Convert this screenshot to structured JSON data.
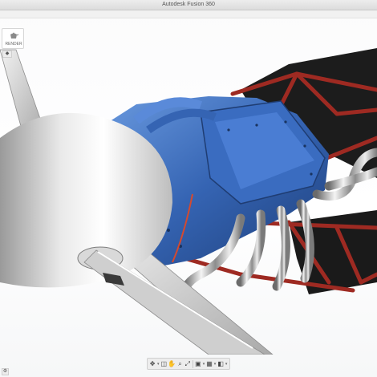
{
  "window": {
    "title": "Autodesk Fusion 360"
  },
  "workspace": {
    "label": "RENDER",
    "icon": "teapot-icon"
  },
  "browser": {
    "toggle_icon": "collapse-icon"
  },
  "settings": {
    "icon": "gear-icon"
  },
  "navbar": {
    "items": [
      {
        "name": "move-icon",
        "glyph": "✥"
      },
      {
        "name": "look-at-icon",
        "glyph": "◫"
      },
      {
        "name": "pan-icon",
        "glyph": "✋"
      },
      {
        "name": "zoom-icon",
        "glyph": "⌕"
      },
      {
        "name": "fit-icon",
        "glyph": "⤢"
      },
      {
        "name": "display-settings-icon",
        "glyph": "▣"
      },
      {
        "name": "grid-icon",
        "glyph": "▦"
      },
      {
        "name": "viewports-icon",
        "glyph": "◧"
      }
    ]
  },
  "colors": {
    "engine_blue": "#3f72c4",
    "frame_red": "#9e2a22",
    "background": "#ffffff"
  }
}
